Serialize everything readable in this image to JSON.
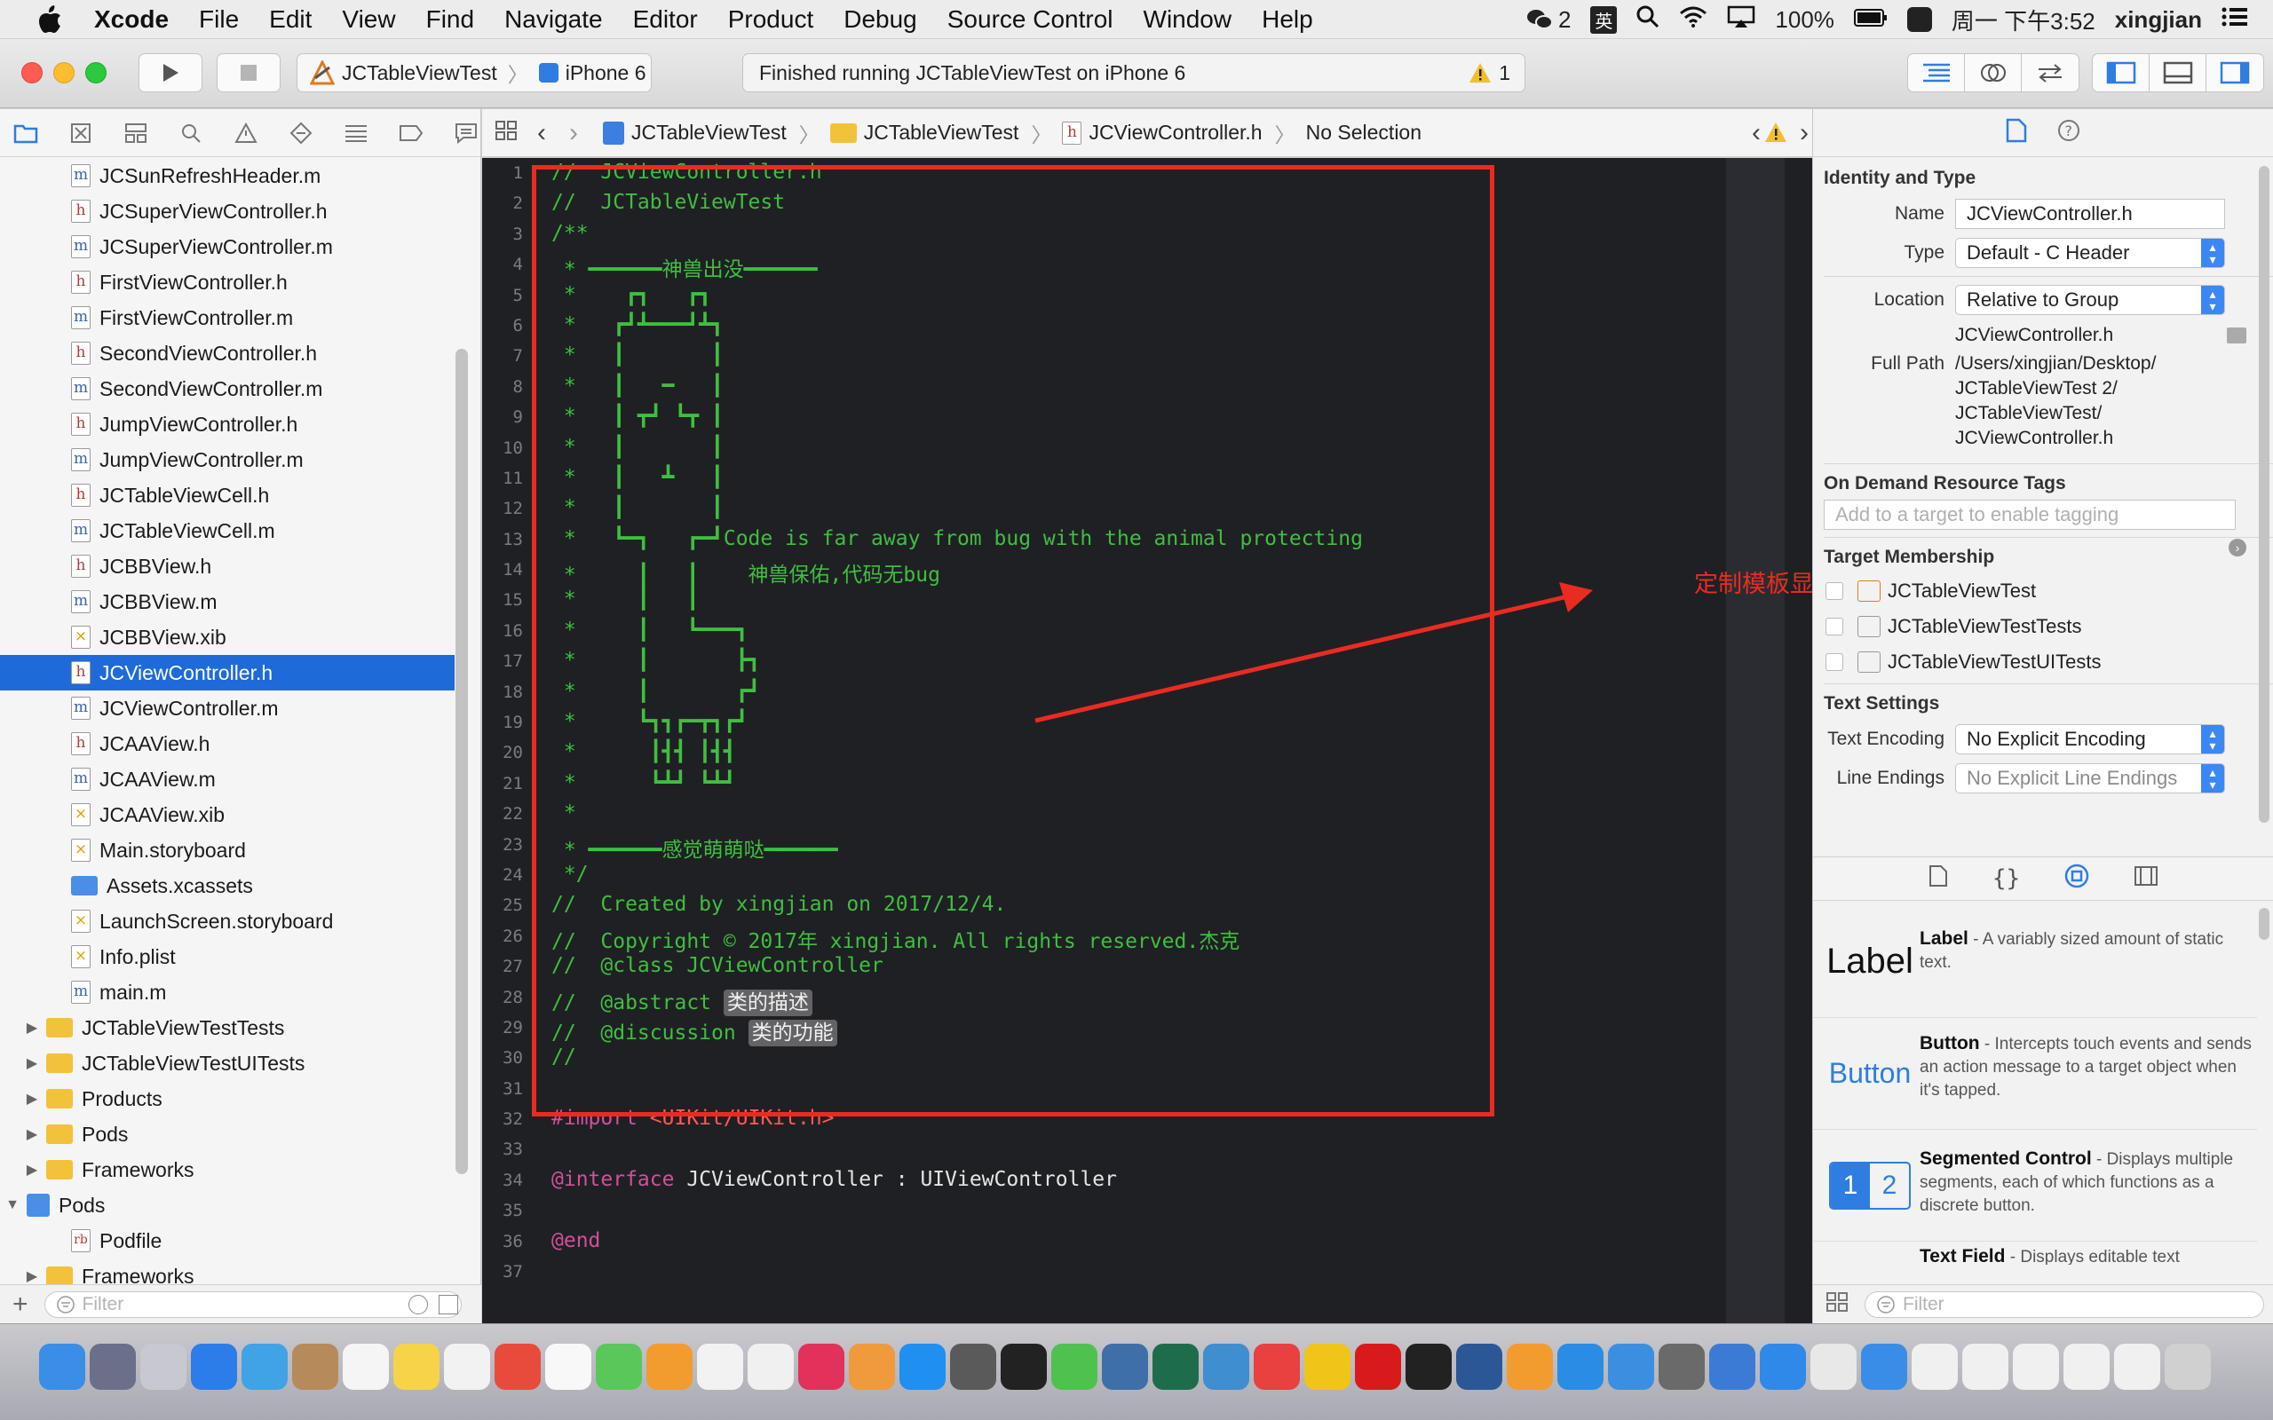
{
  "menubar": {
    "app": "Xcode",
    "items": [
      "File",
      "Edit",
      "View",
      "Find",
      "Navigate",
      "Editor",
      "Product",
      "Debug",
      "Source Control",
      "Window",
      "Help"
    ],
    "wechat_badge": "2",
    "input_method": "英",
    "battery": "100%",
    "clock": "周一 下午3:52",
    "user": "xingjian"
  },
  "toolbar": {
    "scheme": "JCTableViewTest",
    "device": "iPhone 6",
    "activity": "Finished running JCTableViewTest on iPhone 6",
    "warning_count": "1"
  },
  "navigator": {
    "files": [
      {
        "name": "JCSunRefreshHeader.m",
        "kind": "m",
        "indent": 1
      },
      {
        "name": "JCSuperViewController.h",
        "kind": "h",
        "indent": 1
      },
      {
        "name": "JCSuperViewController.m",
        "kind": "m",
        "indent": 1
      },
      {
        "name": "FirstViewController.h",
        "kind": "h",
        "indent": 1
      },
      {
        "name": "FirstViewController.m",
        "kind": "m",
        "indent": 1
      },
      {
        "name": "SecondViewController.h",
        "kind": "h",
        "indent": 1
      },
      {
        "name": "SecondViewController.m",
        "kind": "m",
        "indent": 1
      },
      {
        "name": "JumpViewController.h",
        "kind": "h",
        "indent": 1
      },
      {
        "name": "JumpViewController.m",
        "kind": "m",
        "indent": 1
      },
      {
        "name": "JCTableViewCell.h",
        "kind": "h",
        "indent": 1
      },
      {
        "name": "JCTableViewCell.m",
        "kind": "m",
        "indent": 1
      },
      {
        "name": "JCBBView.h",
        "kind": "h",
        "indent": 1
      },
      {
        "name": "JCBBView.m",
        "kind": "m",
        "indent": 1
      },
      {
        "name": "JCBBView.xib",
        "kind": "x",
        "indent": 1
      },
      {
        "name": "JCViewController.h",
        "kind": "h",
        "indent": 1,
        "selected": true
      },
      {
        "name": "JCViewController.m",
        "kind": "m",
        "indent": 1
      },
      {
        "name": "JCAAView.h",
        "kind": "h",
        "indent": 1
      },
      {
        "name": "JCAAView.m",
        "kind": "m",
        "indent": 1
      },
      {
        "name": "JCAAView.xib",
        "kind": "x",
        "indent": 1
      },
      {
        "name": "Main.storyboard",
        "kind": "x",
        "indent": 1
      },
      {
        "name": "Assets.xcassets",
        "kind": "folder-blue",
        "indent": 1
      },
      {
        "name": "LaunchScreen.storyboard",
        "kind": "x",
        "indent": 1
      },
      {
        "name": "Info.plist",
        "kind": "x",
        "indent": 1
      },
      {
        "name": "main.m",
        "kind": "m",
        "indent": 1
      },
      {
        "name": "JCTableViewTestTests",
        "kind": "folder",
        "indent": 0,
        "disclosure": "▶"
      },
      {
        "name": "JCTableViewTestUITests",
        "kind": "folder",
        "indent": 0,
        "disclosure": "▶"
      },
      {
        "name": "Products",
        "kind": "folder",
        "indent": 0,
        "disclosure": "▶"
      },
      {
        "name": "Pods",
        "kind": "folder",
        "indent": 0,
        "disclosure": "▶"
      },
      {
        "name": "Frameworks",
        "kind": "folder",
        "indent": 0,
        "disclosure": "▶"
      },
      {
        "name": "Pods",
        "kind": "project",
        "indent": -1,
        "disclosure": "▼"
      },
      {
        "name": "Podfile",
        "kind": "rb",
        "indent": 1
      },
      {
        "name": "Frameworks",
        "kind": "folder",
        "indent": 0,
        "disclosure": "▶"
      }
    ],
    "filter_placeholder": "Filter"
  },
  "jumpbar": {
    "crumbs": [
      "JCTableViewTest",
      "JCTableViewTest",
      "JCViewController.h",
      "No Selection"
    ]
  },
  "editor": {
    "lines": [
      "//  JCViewController.h",
      "//  JCTableViewTest",
      "/**",
      " * ━━━━━━神兽出没━━━━━━",
      " *    ┏┓   ┏┓",
      " *   ┏┛┻━━━┛┻┓",
      " *   ┃       ┃",
      " *   ┃   ━   ┃",
      " *   ┃ ┳┛ ┗┳ ┃",
      " *   ┃       ┃",
      " *   ┃   ┻   ┃",
      " *   ┃       ┃",
      " *   ┗━┓   ┏━┛Code is far away from bug with the animal protecting",
      " *     ┃   ┃    神兽保佑,代码无bug",
      " *     ┃   ┃",
      " *     ┃   ┗━━━┓",
      " *     ┃       ┣┓",
      " *     ┃       ┏┛",
      " *     ┗┓┓┏━┳┓┏┛",
      " *      ┃┫┫ ┃┫┫",
      " *      ┗┻┛ ┗┻┛",
      " *",
      " * ━━━━━━感觉萌萌哒━━━━━━",
      " */",
      "//  Created by xingjian on 2017/12/4.",
      "//  Copyright © 2017年 xingjian. All rights reserved.杰克",
      "//  @class JCViewController",
      "//  @abstract ",
      "//  @discussion ",
      "//",
      "",
      "#import <UIKit/UIKit.h>",
      "",
      "@interface JCViewController : UIViewController",
      "",
      "@end",
      ""
    ],
    "placeholders": {
      "abstract": "类的描述",
      "discussion": "类的功能"
    },
    "import_kw": "#import",
    "import_path": "<UIKit/UIKit.h>",
    "interface_kw": "@interface",
    "interface_rest": "JCViewController : UIViewController",
    "end_kw": "@end",
    "annotation": "定制模板显示内容"
  },
  "inspector": {
    "identity_title": "Identity and Type",
    "name_label": "Name",
    "name_value": "JCViewController.h",
    "type_label": "Type",
    "type_value": "Default - C Header",
    "location_label": "Location",
    "location_value": "Relative to Group",
    "location_file": "JCViewController.h",
    "full_path_label": "Full Path",
    "full_path": [
      "/Users/xingjian/Desktop/",
      "JCTableViewTest 2/",
      "JCTableViewTest/",
      "JCViewController.h"
    ],
    "odr_title": "On Demand Resource Tags",
    "odr_placeholder": "Add to a target to enable tagging",
    "tm_title": "Target Membership",
    "targets": [
      "JCTableViewTest",
      "JCTableViewTestTests",
      "JCTableViewTestUITests"
    ],
    "text_settings_title": "Text Settings",
    "encoding_label": "Text Encoding",
    "encoding_value": "No Explicit Encoding",
    "line_endings_label": "Line Endings",
    "line_endings_value": "No Explicit Line Endings"
  },
  "library": {
    "items": [
      {
        "icon_text": "Label",
        "name": "Label",
        "desc": " - A variably sized amount of static text."
      },
      {
        "icon_text": "Button",
        "name": "Button",
        "desc": " - Intercepts touch events and sends an action message to a target object when it's tapped."
      },
      {
        "icon_text": "12",
        "name": "Segmented Control",
        "desc": " - Displays multiple segments, each of which functions as a discrete button."
      },
      {
        "icon_text": "",
        "name": "Text Field",
        "desc": " - Displays editable text"
      }
    ],
    "filter_placeholder": "Filter"
  },
  "colors": {
    "selection": "#1e6ad8",
    "editor_bg": "#1f2024",
    "comment": "#3fbf3f",
    "keyword": "#d0509b",
    "string": "#ff5a52",
    "annotation_red": "#ea2b21"
  }
}
